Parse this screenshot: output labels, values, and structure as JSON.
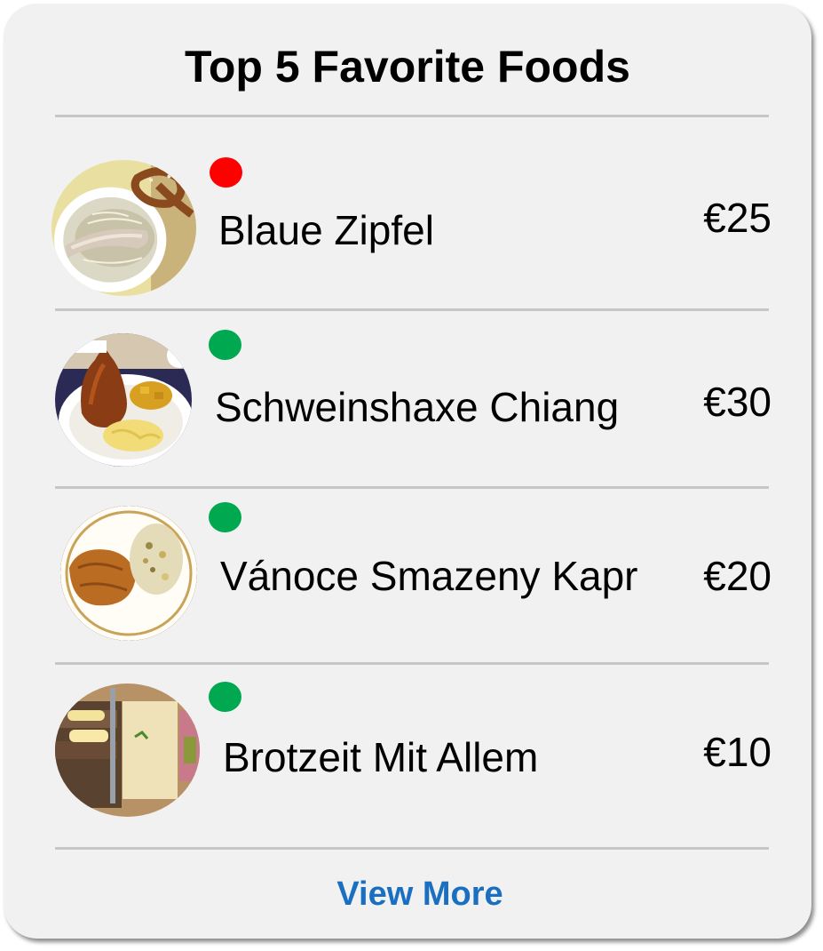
{
  "header": {
    "title": "Top 5 Favorite Foods"
  },
  "items": [
    {
      "name": "Blaue Zipfel",
      "price": "€25",
      "status_color": "#ff0000",
      "image": "sausage-plate-image"
    },
    {
      "name": "Schweinshaxe Chiang",
      "price": "€30",
      "status_color": "#00a850",
      "image": "pork-knuckle-plate-image"
    },
    {
      "name": "Vánoce Smazeny Kapr",
      "price": "€20",
      "status_color": "#00a850",
      "image": "fried-carp-plate-image"
    },
    {
      "name": "Brotzeit Mit Allem",
      "price": "€10",
      "status_color": "#00a850",
      "image": "brotzeit-board-image"
    }
  ],
  "footer": {
    "view_more_label": "View More",
    "link_color": "#1a6fc1"
  }
}
